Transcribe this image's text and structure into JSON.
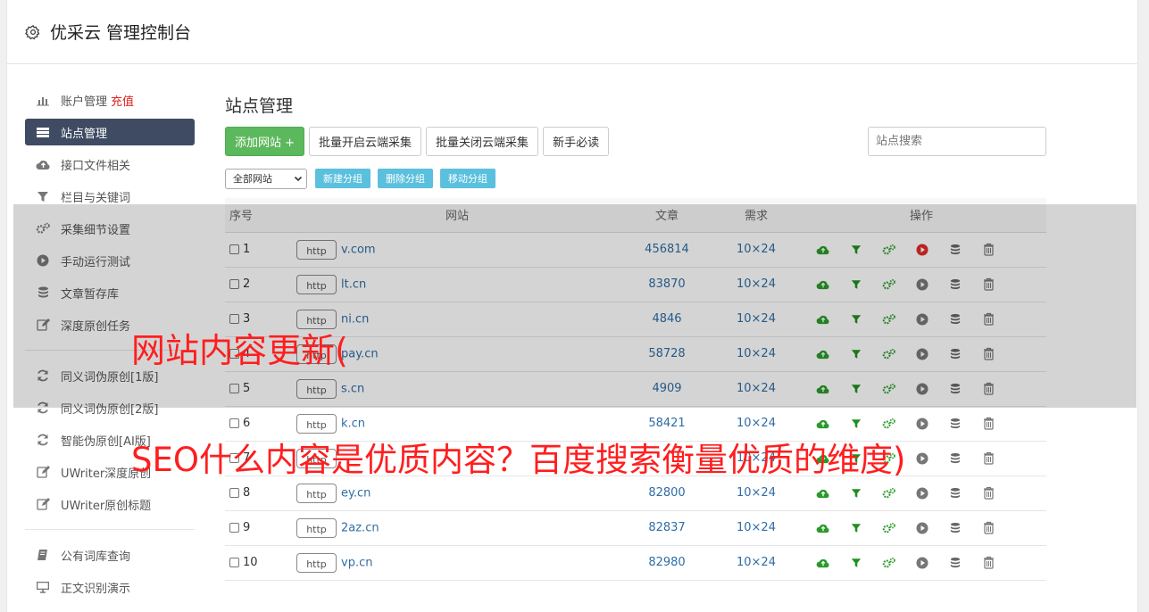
{
  "app": {
    "title": "优采云 管理控制台"
  },
  "sidebar": {
    "group1": [
      {
        "label": "账户管理",
        "extra": "充值",
        "icon": "bar-chart-icon"
      },
      {
        "label": "站点管理",
        "icon": "server-icon",
        "active": true
      },
      {
        "label": "接口文件相关",
        "icon": "cloud-upload-icon"
      },
      {
        "label": "栏目与关键词",
        "icon": "filter-icon"
      },
      {
        "label": "采集细节设置",
        "icon": "cogs-icon"
      },
      {
        "label": "手动运行测试",
        "icon": "play-circle-icon"
      },
      {
        "label": "文章暂存库",
        "icon": "database-icon"
      },
      {
        "label": "深度原创任务",
        "icon": "edit-icon"
      }
    ],
    "group2": [
      {
        "label": "同义词伪原创[1版]",
        "icon": "refresh-icon"
      },
      {
        "label": "同义词伪原创[2版]",
        "icon": "refresh-icon"
      },
      {
        "label": "智能伪原创[AI版]",
        "icon": "refresh-icon"
      },
      {
        "label": "UWriter深度原创",
        "icon": "edit-icon"
      },
      {
        "label": "UWriter原创标题",
        "icon": "edit-icon"
      }
    ],
    "group3": [
      {
        "label": "公有词库查询",
        "icon": "book-icon"
      },
      {
        "label": "正文识别演示",
        "icon": "monitor-icon"
      }
    ]
  },
  "main": {
    "title": "站点管理",
    "toolbar": {
      "add": "添加网站 +",
      "batch_on": "批量开启云端采集",
      "batch_off": "批量关闭云端采集",
      "guide": "新手必读",
      "search_placeholder": "站点搜索"
    },
    "filter": {
      "select_value": "全部网站",
      "new_group": "新建分组",
      "del_group": "删除分组",
      "move_group": "移动分组"
    },
    "table": {
      "headers": [
        "序号",
        "网站",
        "文章",
        "需求",
        "操作"
      ],
      "rows": [
        {
          "idx": "1",
          "scheme": "http",
          "site": "v.com",
          "articles": "456814",
          "demand": "10×24"
        },
        {
          "idx": "2",
          "scheme": "http",
          "site": "lt.cn",
          "articles": "83870",
          "demand": "10×24"
        },
        {
          "idx": "3",
          "scheme": "http",
          "site": "ni.cn",
          "articles": "4846",
          "demand": "10×24"
        },
        {
          "idx": "4",
          "scheme": "http",
          "site": "pay.cn",
          "articles": "58728",
          "demand": "10×24"
        },
        {
          "idx": "5",
          "scheme": "http",
          "site": "s.cn",
          "articles": "4909",
          "demand": "10×24"
        },
        {
          "idx": "6",
          "scheme": "http",
          "site": "k.cn",
          "articles": "58421",
          "demand": "10×24"
        },
        {
          "idx": "7",
          "scheme": "http",
          "site": "",
          "articles": "",
          "demand": "10×24"
        },
        {
          "idx": "8",
          "scheme": "http",
          "site": "ey.cn",
          "articles": "82800",
          "demand": "10×24"
        },
        {
          "idx": "9",
          "scheme": "http",
          "site": "2az.cn",
          "articles": "82837",
          "demand": "10×24"
        },
        {
          "idx": "10",
          "scheme": "http",
          "site": "vp.cn",
          "articles": "82980",
          "demand": "10×24"
        }
      ]
    }
  },
  "overlay": {
    "caption1": "网站内容更新(",
    "caption2": "SEO什么内容是优质内容？百度搜索衡量优质的维度)"
  },
  "colors": {
    "accent": "#3e4b63",
    "green": "#5cb85c",
    "info": "#5bc0de",
    "link": "#2e6da4",
    "caption": "#ff1e1e"
  }
}
